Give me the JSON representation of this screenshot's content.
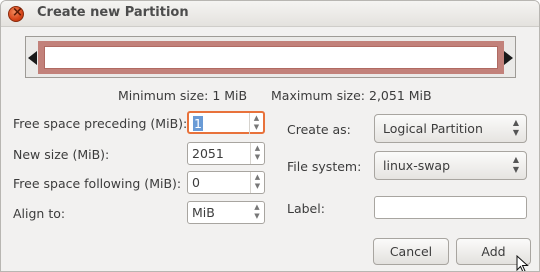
{
  "window": {
    "title": "Create new Partition"
  },
  "size_info": {
    "minimum": "Minimum size: 1 MiB",
    "maximum": "Maximum size: 2,051 MiB"
  },
  "left_form": {
    "free_preceding": {
      "label": "Free space preceding (MiB):",
      "value": "1"
    },
    "new_size": {
      "label": "New size (MiB):",
      "value": "2051"
    },
    "free_following": {
      "label": "Free space following (MiB):",
      "value": "0"
    },
    "align_to": {
      "label": "Align to:",
      "value": "MiB"
    }
  },
  "right_form": {
    "create_as": {
      "label": "Create as:",
      "value": "Logical Partition"
    },
    "file_system": {
      "label": "File system:",
      "value": "linux-swap"
    },
    "partition_label": {
      "label": "Label:",
      "value": ""
    }
  },
  "buttons": {
    "cancel": "Cancel",
    "add": "Add"
  },
  "colors": {
    "partition_border": "#c2817a",
    "focus": "#e8723b",
    "close": "#d8461a"
  },
  "icons": [
    "close-icon",
    "resize-left-handle",
    "resize-right-handle",
    "spin-arrows-icon",
    "combo-arrows-icon",
    "mouse-pointer-icon"
  ]
}
